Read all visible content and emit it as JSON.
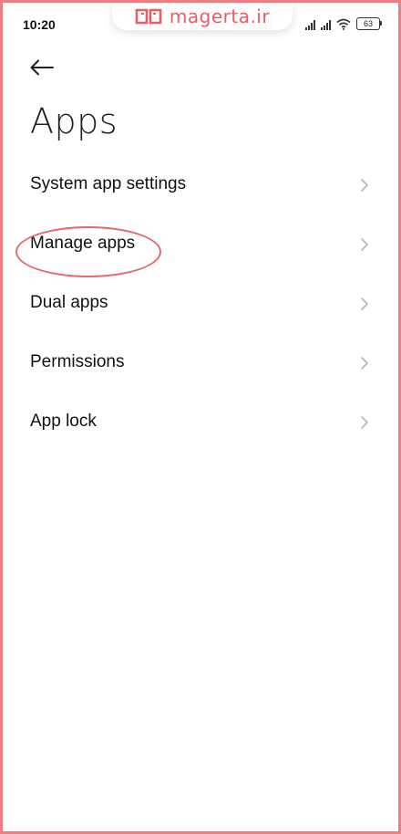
{
  "status_bar": {
    "time": "10:20",
    "battery": "63"
  },
  "watermark": {
    "text": "magerta.ir",
    "color": "#e45f66"
  },
  "header": {
    "back_icon": "arrow-left-icon",
    "title": "Apps"
  },
  "menu": {
    "items": [
      {
        "label": "System app settings"
      },
      {
        "label": "Manage apps",
        "highlighted": true
      },
      {
        "label": "Dual apps"
      },
      {
        "label": "Permissions"
      },
      {
        "label": "App lock"
      }
    ]
  },
  "colors": {
    "frame_border": "#ee7d7f",
    "highlight": "#e5686b"
  }
}
